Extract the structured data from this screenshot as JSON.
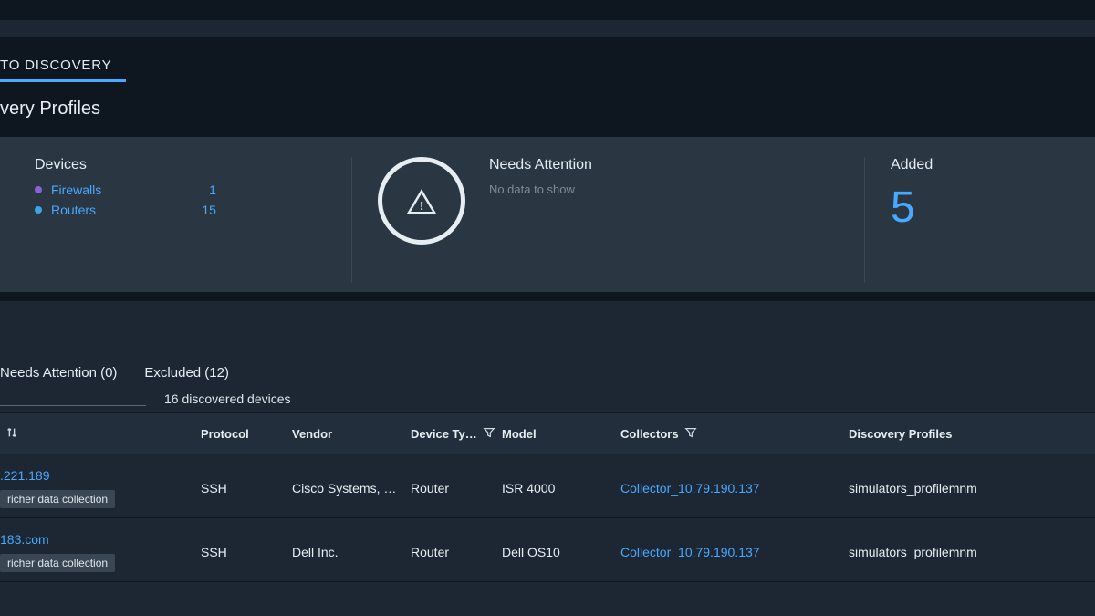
{
  "tabs": {
    "auto_discovery": "TO DISCOVERY"
  },
  "subhead": "very Profiles",
  "summary": {
    "devices_title": "Devices",
    "legend": [
      {
        "label": "Firewalls",
        "count": "1",
        "color": "purple"
      },
      {
        "label": "Routers",
        "count": "15",
        "color": "blue"
      }
    ],
    "attention_title": "Needs Attention",
    "attention_empty": "No data to show",
    "added_title": "Added",
    "added_count": "5"
  },
  "filter_tabs": {
    "needs_attention": "Needs Attention (0)",
    "excluded": "Excluded (12)"
  },
  "discovered_count_text": "16 discovered devices",
  "columns": {
    "name": "",
    "protocol": "Protocol",
    "vendor": "Vendor",
    "device_type": "Device Ty…",
    "model": "Model",
    "collectors": "Collectors",
    "discovery_profiles": "Discovery Profiles"
  },
  "rows": [
    {
      "name": ".221.189",
      "badge": "richer data collection",
      "protocol": "SSH",
      "vendor": "Cisco Systems, …",
      "device_type": "Router",
      "model": "ISR 4000",
      "collector": "Collector_10.79.190.137",
      "profile": "simulators_profilemnm"
    },
    {
      "name": "183.com",
      "badge": "richer data collection",
      "protocol": "SSH",
      "vendor": "Dell Inc.",
      "device_type": "Router",
      "model": "Dell OS10",
      "collector": "Collector_10.79.190.137",
      "profile": "simulators_profilemnm"
    }
  ],
  "chart_data": {
    "type": "bar",
    "title": "Devices",
    "categories": [
      "Firewalls",
      "Routers"
    ],
    "values": [
      1,
      15
    ],
    "xlabel": "",
    "ylabel": "",
    "ylim": [
      0,
      16
    ]
  }
}
